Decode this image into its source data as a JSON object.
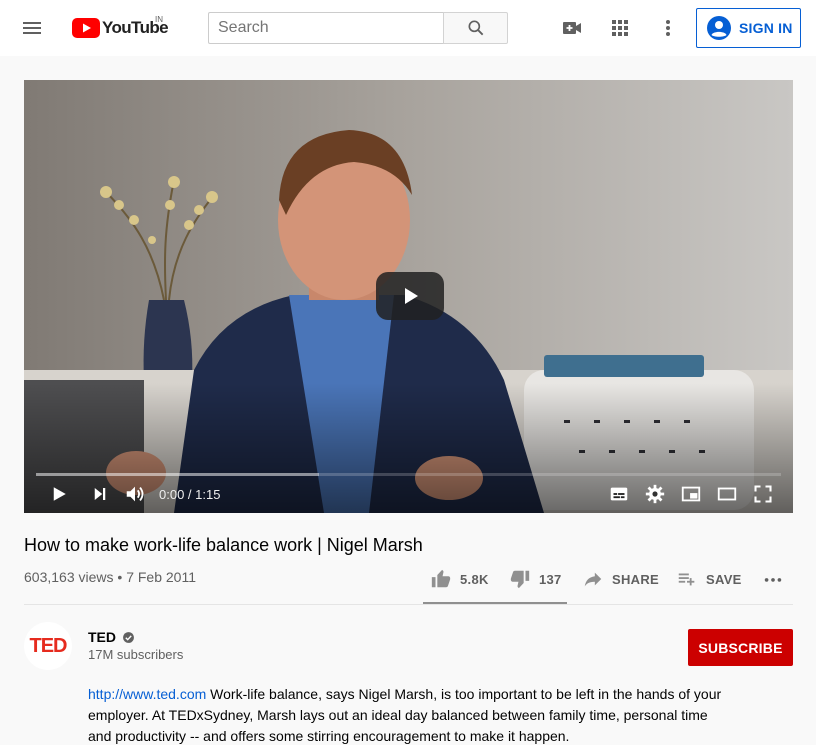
{
  "header": {
    "logo_text": "YouTube",
    "region": "IN",
    "search_placeholder": "Search",
    "sign_in_label": "SIGN IN",
    "icons": [
      "menu-icon",
      "youtube-logo-icon",
      "search-icon",
      "create-video-icon",
      "apps-grid-icon",
      "more-vert-icon",
      "account-icon"
    ]
  },
  "player": {
    "time_current": "0:00",
    "time_separator": " / ",
    "time_total": "1:15",
    "buffered_fraction": 0.38,
    "controls": [
      "play-icon",
      "next-icon",
      "volume-icon",
      "subtitles-icon",
      "settings-icon",
      "miniplayer-icon",
      "theater-icon",
      "fullscreen-icon"
    ]
  },
  "video": {
    "title": "How to make work-life balance work | Nigel Marsh",
    "views": "603,163 views",
    "bullet": " • ",
    "date": "7 Feb 2011",
    "likes": "5.8K",
    "dislikes": "137",
    "share_label": "SHARE",
    "save_label": "SAVE",
    "like_fraction": 0.98
  },
  "channel": {
    "avatar_text": "TED",
    "name": "TED",
    "subscribers": "17M subscribers",
    "subscribe_label": "SUBSCRIBE"
  },
  "description": {
    "link": "http://www.ted.com",
    "text": " Work-life balance, says Nigel Marsh, is too important to be left in the hands of your employer. At TEDxSydney, Marsh lays out an ideal day balanced between family time, personal time and productivity -- and offers some stirring encouragement to make it happen."
  },
  "colors": {
    "brand_red": "#ff0000",
    "subscribe_red": "#cc0000",
    "link_blue": "#065fd4",
    "text_secondary": "#606060"
  }
}
